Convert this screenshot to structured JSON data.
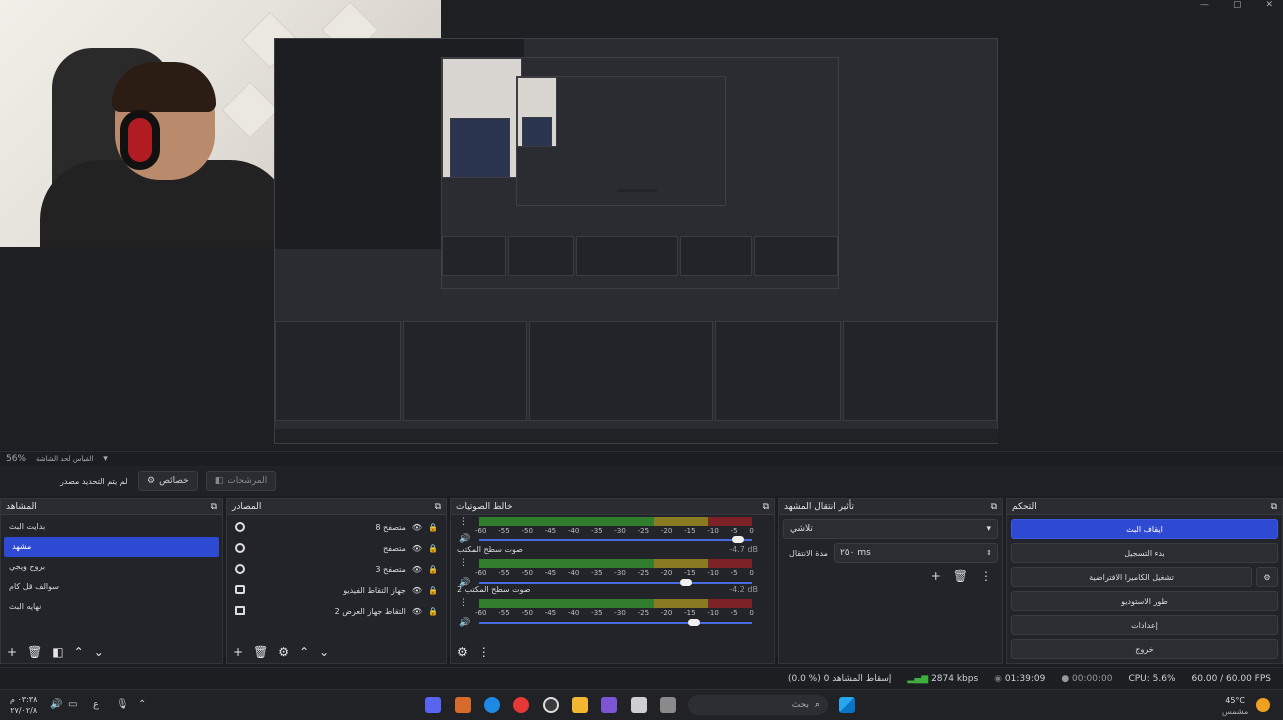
{
  "preview": {
    "zoom": "56%",
    "scene_label": "القياس لحد الشاشة"
  },
  "toolbar": {
    "no_source": "لم يتم التحديد مصدر",
    "properties": "خصائص",
    "filters": "المرشحات"
  },
  "scenes": {
    "title": "المشاهد",
    "items": [
      "بدايت البث",
      "مشهد",
      "بروح ويجي",
      "سوالف قل كام",
      "نهايه البث"
    ],
    "active_index": 1
  },
  "sources": {
    "title": "المصادر",
    "items": [
      {
        "label": "متصفح 8",
        "icon": "browser-icon"
      },
      {
        "label": "متصفح",
        "icon": "browser-icon"
      },
      {
        "label": "متصفح 3",
        "icon": "browser-icon"
      },
      {
        "label": "جهاز التقاط الفيديو",
        "icon": "camera-icon"
      },
      {
        "label": "التقاط جهاز العرض 2",
        "icon": "monitor-icon"
      }
    ]
  },
  "mixer": {
    "title": "خالط الصوتيات",
    "ticks": [
      "-60",
      "-55",
      "-50",
      "-45",
      "-40",
      "-35",
      "-30",
      "-25",
      "-20",
      "-15",
      "-10",
      "-5",
      "0"
    ],
    "channels": [
      {
        "name": "",
        "db": "",
        "level": 0.0,
        "volume": 0.97
      },
      {
        "name": "صوت سطح المكتب",
        "db": "-4.7 dB",
        "level": 0.0,
        "volume": 0.78
      },
      {
        "name": "2 صوت سطح المكتب",
        "db": "-4.2 dB",
        "level": 0.0,
        "volume": 0.81
      }
    ]
  },
  "transition": {
    "title": "تأثير انتقال المشهد",
    "type": "تلاشي",
    "duration_label": "مدة الانتقال",
    "duration_value": "٢٥٠ ms"
  },
  "controls": {
    "title": "التحكم",
    "stop_stream": "ايقاف البث",
    "start_record": "بدء التسجيل",
    "virtual_cam": "تشغيل الكاميرا الافتراضية",
    "studio_mode": "طور الاستوديو",
    "settings": "إعدادات",
    "exit": "خروج"
  },
  "status": {
    "fps": "60.00 / 60.00 FPS",
    "cpu": "CPU: 5.6%",
    "rec_time": "00:00:00",
    "stream_time": "01:39:09",
    "bitrate": "2874 kbps",
    "dropped": "(0.0 %) إسقاط المشاهد 0"
  },
  "taskbar": {
    "search": "بحث",
    "weather_temp": "45°C",
    "weather_desc": "مشمس",
    "time": "٠٣:٣٨ م",
    "date": "٢٧/٠٢/٨",
    "lang": "ع"
  },
  "colors": {
    "accent": "#2e4ad3",
    "meter_green": "#2f7d2d",
    "meter_yellow": "#8a7a22",
    "meter_red": "#7d2227"
  }
}
